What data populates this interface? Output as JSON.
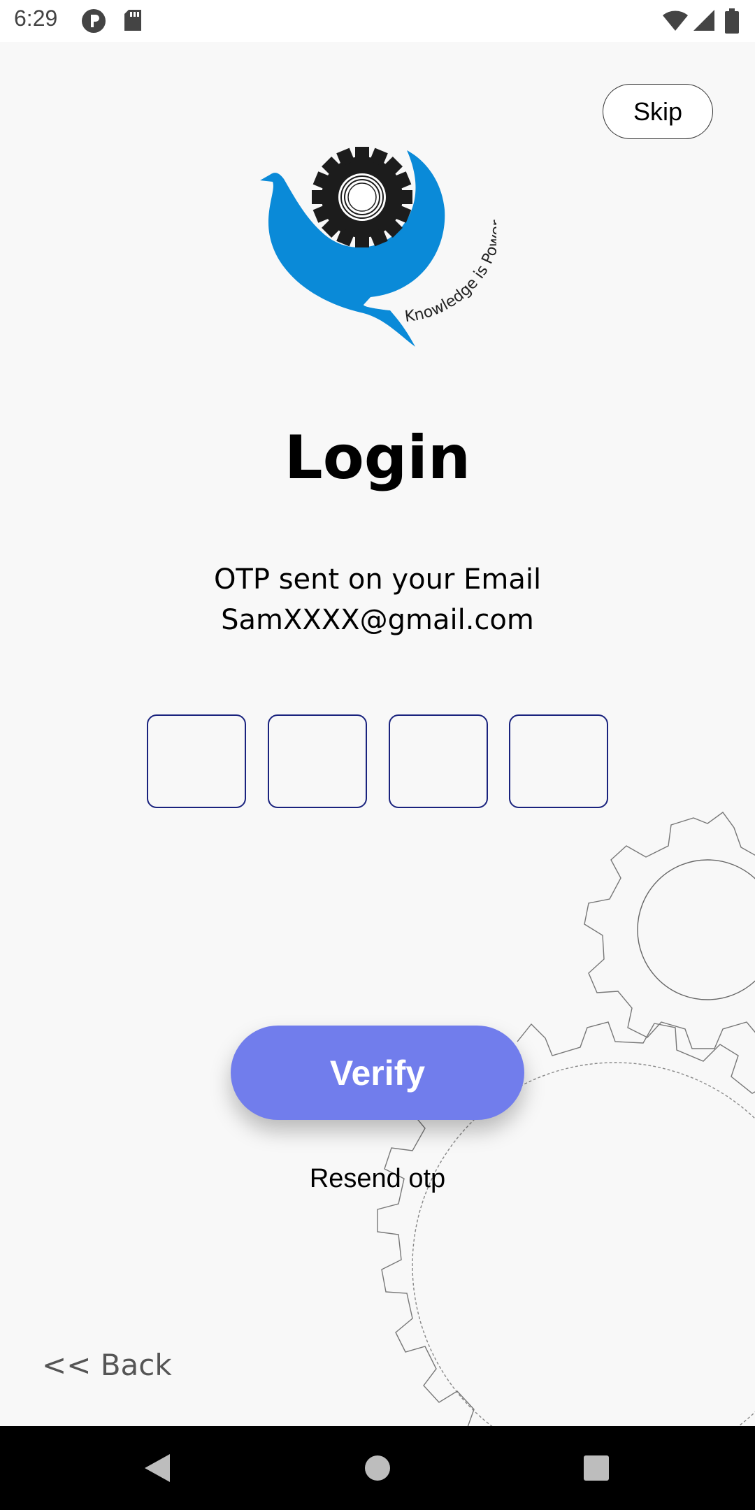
{
  "status_bar": {
    "time": "6:29",
    "icons": [
      "app-p-icon",
      "sd-card-icon",
      "wifi-icon",
      "signal-icon",
      "battery-icon"
    ]
  },
  "skip_label": "Skip",
  "logo": {
    "tagline": "Knowledge is Power",
    "colors": {
      "bird": "#0a8ad8",
      "gear": "#1c1c1c"
    }
  },
  "title": "Login",
  "otp_message": {
    "line1": "OTP sent on your Email",
    "line2": "SamXXXX@gmail.com"
  },
  "otp_inputs": [
    {
      "value": ""
    },
    {
      "value": ""
    },
    {
      "value": ""
    },
    {
      "value": ""
    }
  ],
  "verify_label": "Verify",
  "resend_label": "Resend otp",
  "back_label": "<< Back",
  "colors": {
    "accent": "#717dec",
    "otp_border": "#1a237e",
    "background": "#f8f8f8"
  },
  "nav_bar": {
    "buttons": [
      "back-triangle-icon",
      "home-circle-icon",
      "recents-square-icon"
    ]
  }
}
